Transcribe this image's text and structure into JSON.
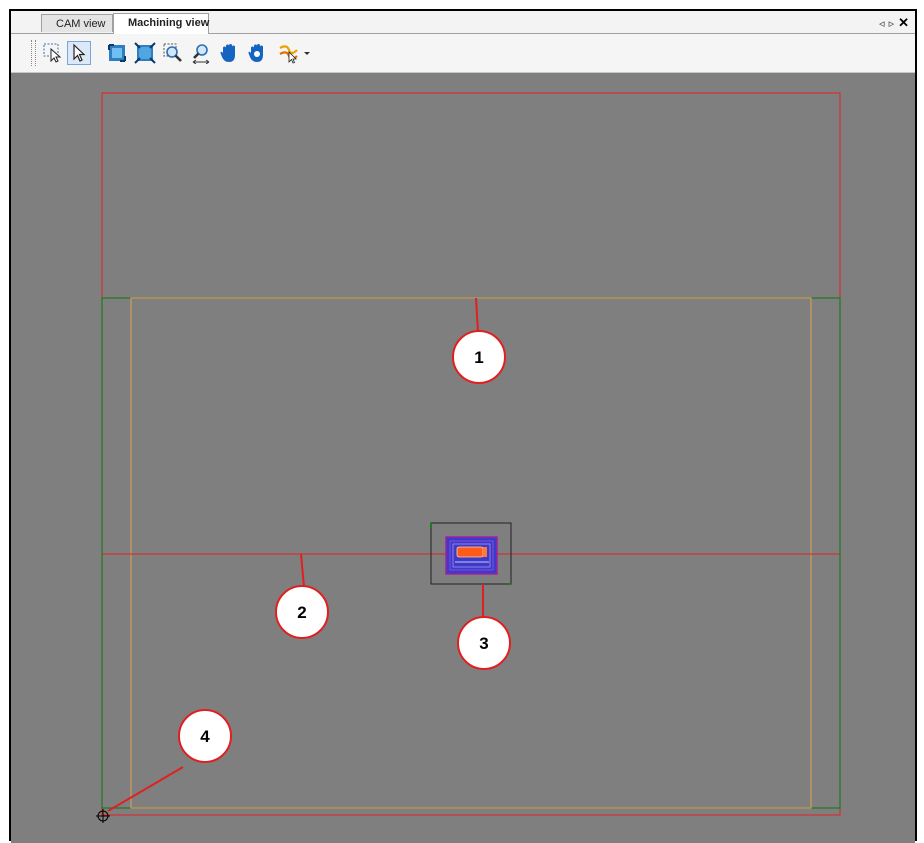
{
  "tabs": [
    {
      "label": "CAM view",
      "active": false
    },
    {
      "label": "Machining view",
      "active": true
    }
  ],
  "tab_controls": {
    "prev": "◃",
    "next": "▹",
    "close": "✕"
  },
  "toolbar": {
    "tools": [
      {
        "name": "select-area-icon",
        "active": false
      },
      {
        "name": "select-pointer-icon",
        "active": true
      },
      {
        "name": "zoom-extents-icon",
        "active": false
      },
      {
        "name": "zoom-all-icon",
        "active": false
      },
      {
        "name": "zoom-window-icon",
        "active": false
      },
      {
        "name": "zoom-dynamic-icon",
        "active": false
      },
      {
        "name": "pan-hand-icon",
        "active": false
      },
      {
        "name": "rotate-hand-icon",
        "active": false
      },
      {
        "name": "toolpath-display-icon",
        "active": false
      }
    ]
  },
  "viewport": {
    "background": "#7f7f7f",
    "colors": {
      "machine_limits": "#e02020",
      "table": "#1f7a1f",
      "stock": "#e0a050",
      "part_box": "#202020"
    }
  },
  "callouts": [
    {
      "label": "1"
    },
    {
      "label": "2"
    },
    {
      "label": "3"
    },
    {
      "label": "4"
    }
  ]
}
